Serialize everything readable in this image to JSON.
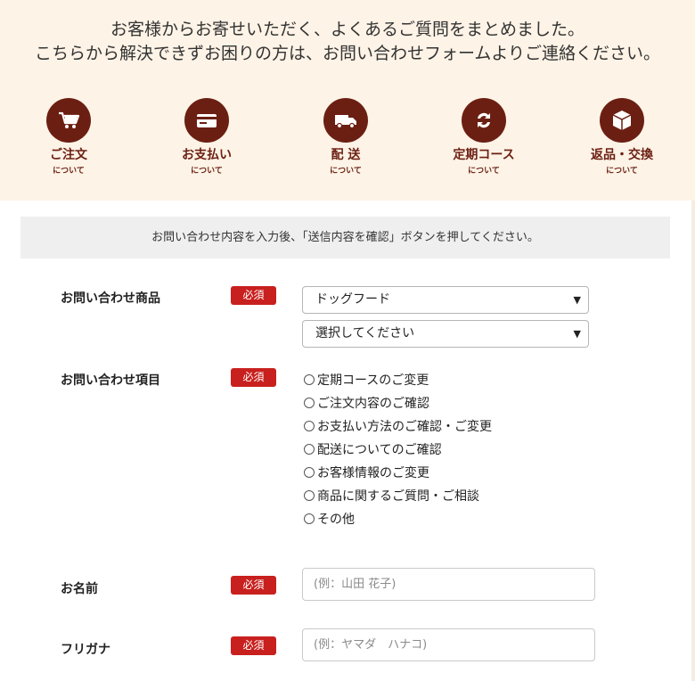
{
  "intro": {
    "line1": "お客様からお寄せいただく、よくあるご質問をまとめました。",
    "line2": "こちらから解決できずお困りの方は、お問い合わせフォームよりご連絡ください。"
  },
  "categories": [
    {
      "title": "ご注文",
      "sub": "について",
      "icon": "cart-icon"
    },
    {
      "title": "お支払い",
      "sub": "について",
      "icon": "card-icon"
    },
    {
      "title": "配 送",
      "sub": "について",
      "icon": "truck-icon"
    },
    {
      "title": "定期コース",
      "sub": "について",
      "icon": "cycle-icon"
    },
    {
      "title": "返品・交換",
      "sub": "について",
      "icon": "box-icon"
    }
  ],
  "notice": "お問い合わせ内容を入力後、「送信内容を確認」ボタンを押してください。",
  "required_label": "必須",
  "form": {
    "product": {
      "label": "お問い合わせ商品",
      "select1": "ドッグフード",
      "select2": "選択してください"
    },
    "topic": {
      "label": "お問い合わせ項目",
      "options": [
        "定期コースのご変更",
        "ご注文内容のご確認",
        "お支払い方法のご確認・ご変更",
        "配送についてのご確認",
        "お客様情報のご変更",
        "商品に関するご質問・ご相談",
        "その他"
      ]
    },
    "name": {
      "label": "お名前",
      "placeholder": "(例：山田 花子)"
    },
    "kana": {
      "label": "フリガナ",
      "placeholder": "(例：ヤマダ　ハナコ)"
    }
  },
  "colors": {
    "accent": "#6b1f12",
    "required": "#c8201e",
    "header_bg": "#fdf3e6",
    "notice_bg": "#efefef"
  }
}
